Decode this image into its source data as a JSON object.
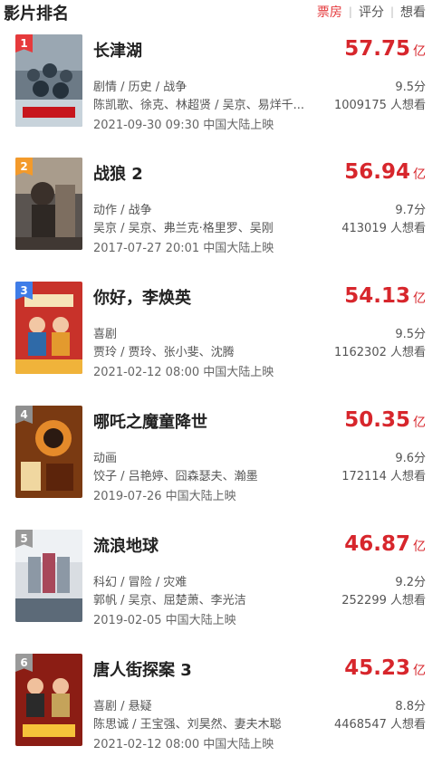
{
  "header": {
    "title": "影片排名",
    "tabs": [
      "票房",
      "评分",
      "想看"
    ],
    "active_tab": 0
  },
  "colors": {
    "accent": "#d7262c",
    "rank_badges": [
      "#e63a3c",
      "#f39a2b",
      "#3f7de8",
      "#8f8f8f",
      "#9a9a9a",
      "#9a9a9a"
    ]
  },
  "movies": [
    {
      "rank": "1",
      "title": "长津湖",
      "box_office": "57.75",
      "box_unit": "亿",
      "genre": "剧情 / 历史 / 战争",
      "rating": "9.5分",
      "cast": "陈凯歌、徐克、林超贤 / 吴京、易烊千...",
      "want": "1009175 人想看",
      "release": "2021-09-30 09:30 中国大陆上映"
    },
    {
      "rank": "2",
      "title": "战狼 2",
      "box_office": "56.94",
      "box_unit": "亿",
      "genre": "动作 / 战争",
      "rating": "9.7分",
      "cast": "吴京 / 吴京、弗兰克·格里罗、吴刚",
      "want": "413019 人想看",
      "release": "2017-07-27 20:01 中国大陆上映"
    },
    {
      "rank": "3",
      "title": "你好，李焕英",
      "box_office": "54.13",
      "box_unit": "亿",
      "genre": "喜剧",
      "rating": "9.5分",
      "cast": "贾玲 / 贾玲、张小斐、沈腾",
      "want": "1162302 人想看",
      "release": "2021-02-12 08:00 中国大陆上映"
    },
    {
      "rank": "4",
      "title": "哪吒之魔童降世",
      "box_office": "50.35",
      "box_unit": "亿",
      "genre": "动画",
      "rating": "9.6分",
      "cast": "饺子 / 吕艳婷、囧森瑟夫、瀚墨",
      "want": "172114 人想看",
      "release": "2019-07-26 中国大陆上映"
    },
    {
      "rank": "5",
      "title": "流浪地球",
      "box_office": "46.87",
      "box_unit": "亿",
      "genre": "科幻 / 冒险 / 灾难",
      "rating": "9.2分",
      "cast": "郭帆 / 吴京、屈楚萧、李光洁",
      "want": "252299 人想看",
      "release": "2019-02-05 中国大陆上映"
    },
    {
      "rank": "6",
      "title": "唐人街探案 3",
      "box_office": "45.23",
      "box_unit": "亿",
      "genre": "喜剧 / 悬疑",
      "rating": "8.8分",
      "cast": "陈思诚 / 王宝强、刘昊然、妻夫木聪",
      "want": "4468547 人想看",
      "release": "2021-02-12 08:00 中国大陆上映"
    }
  ]
}
